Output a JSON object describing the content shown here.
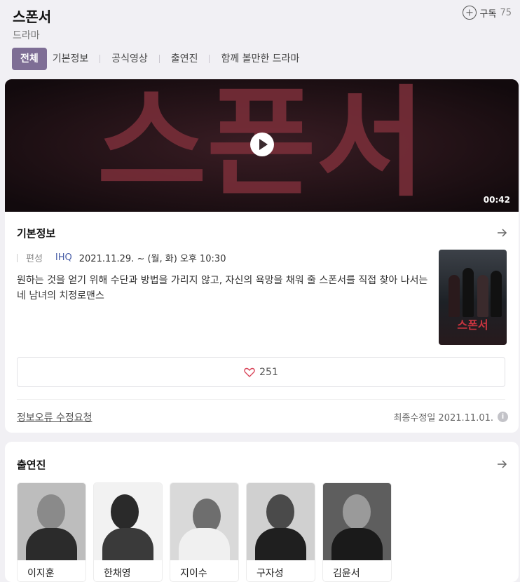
{
  "header": {
    "title": "스폰서",
    "genre": "드라마",
    "subscribe_label": "구독",
    "subscribe_count": "75"
  },
  "tabs": [
    {
      "label": "전체",
      "active": true
    },
    {
      "label": "기본정보",
      "active": false
    },
    {
      "label": "공식영상",
      "active": false
    },
    {
      "label": "출연진",
      "active": false
    },
    {
      "label": "함께 볼만한 드라마",
      "active": false
    }
  ],
  "video": {
    "title_art": "스폰서",
    "duration": "00:42"
  },
  "basic_info": {
    "section_title": "기본정보",
    "broadcast_label": "편성",
    "channel": "IHQ",
    "schedule": "2021.11.29. ~  (월, 화) 오후 10:30",
    "description": "원하는 것을 얻기 위해 수단과 방법을 가리지 않고, 자신의 욕망을 채워 줄 스폰서를 직접 찾아 나서는 네 남녀의 치정로맨스",
    "poster_title": "스폰서",
    "like_count": "251",
    "report_label": "정보오류 수정요청",
    "updated_label": "최종수정일 2021.11.01."
  },
  "cast": {
    "section_title": "출연진",
    "members": [
      {
        "name": "이지훈"
      },
      {
        "name": "한채영"
      },
      {
        "name": "지이수"
      },
      {
        "name": "구자성"
      },
      {
        "name": "김윤서"
      }
    ]
  },
  "colors": {
    "accent": "#7e6e95",
    "channel_link": "#4a5fa8",
    "background": "#f1f0f4"
  },
  "icons": [
    "plus-circle-icon",
    "play-icon",
    "arrow-right-icon",
    "heart-icon",
    "info-icon"
  ]
}
